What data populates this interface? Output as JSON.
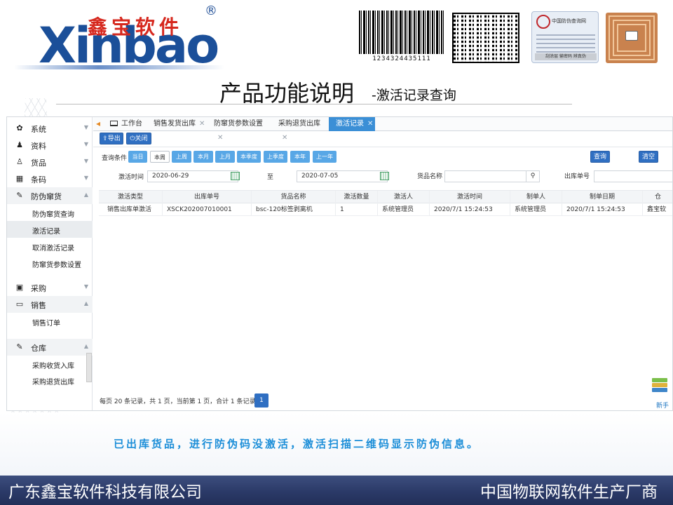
{
  "brand": {
    "name_cn": "鑫宝软件",
    "name_en": "Xinbao",
    "reg_mark": "®",
    "barcode_digits": "1234324435111",
    "label_title": "中国防伪查询网",
    "label_footer": "刮涂层 输密码 辨真伪"
  },
  "slide": {
    "title": "产品功能说明",
    "subtitle": "-激活记录查询",
    "caption": "已出库货品，进行防伪码没激活，激活扫描二维码显示防伪信息。",
    "footer_left": "广东鑫宝软件科技有限公司",
    "footer_right": "中国物联网软件生产厂商"
  },
  "sidebar": {
    "items": [
      {
        "label": "系统",
        "icon": "gear-icon",
        "glyph": "✿"
      },
      {
        "label": "资料",
        "icon": "user-icon",
        "glyph": "♟"
      },
      {
        "label": "货品",
        "icon": "person-icon",
        "glyph": "♙"
      },
      {
        "label": "条码",
        "icon": "barcode-icon",
        "glyph": "▦"
      },
      {
        "label": "防伪窜货",
        "icon": "edit-icon",
        "glyph": "✎"
      },
      {
        "label": "采购",
        "icon": "id-card-icon",
        "glyph": "▣"
      },
      {
        "label": "销售",
        "icon": "monitor-icon",
        "glyph": "▭"
      },
      {
        "label": "仓库",
        "icon": "edit-icon",
        "glyph": "✎"
      }
    ],
    "anti_fake_sub": [
      "防伪窜货查询",
      "激活记录",
      "取消激活记录",
      "防窜货参数设置"
    ],
    "sales_sub": [
      "销售订单"
    ],
    "warehouse_sub": [
      "采购收货入库",
      "采购退货出库"
    ]
  },
  "tabs": [
    "工作台",
    "销售发货出库",
    "防窜货参数设置",
    "采购退货出库",
    "激活记录"
  ],
  "toolbar": {
    "export": "导出",
    "close": "关闭"
  },
  "query": {
    "label": "查询条件",
    "chips": [
      "当日",
      "本周",
      "上周",
      "本月",
      "上月",
      "本季度",
      "上季度",
      "本年",
      "上一年"
    ],
    "selected_chip": "本周",
    "search": "查询",
    "clear": "清空",
    "time_label": "激活时间",
    "date_from": "2020-06-29",
    "to_label": "至",
    "date_to": "2020-07-05",
    "goods_label": "货品名称",
    "goods_value": "",
    "outno_label": "出库单号",
    "outno_value": ""
  },
  "grid": {
    "columns": [
      "激活类型",
      "出库单号",
      "货品名称",
      "激活数量",
      "激活人",
      "激活时间",
      "制单人",
      "制单日期",
      "仓"
    ],
    "rows": [
      [
        "销售出库单激活",
        "XSCK202007010001",
        "bsc-120标签剥离机",
        "1",
        "系统管理员",
        "2020/7/1 15:24:53",
        "系统管理员",
        "2020/7/1 15:24:53",
        "鑫宝软"
      ]
    ]
  },
  "pager": {
    "text": "每页 20 条记录，共 1 页，当前第 1 页，合计 1 条记录",
    "page": "1"
  },
  "corner": {
    "label": "新手"
  },
  "colors": {
    "accent": "#2f6fc2",
    "tab_active": "#3b8fd6",
    "chip": "#58a7e6",
    "logo_blue": "#1b4f99",
    "logo_red": "#d6281e",
    "footer": "#2b3a68",
    "caption": "#1c8ed8"
  }
}
